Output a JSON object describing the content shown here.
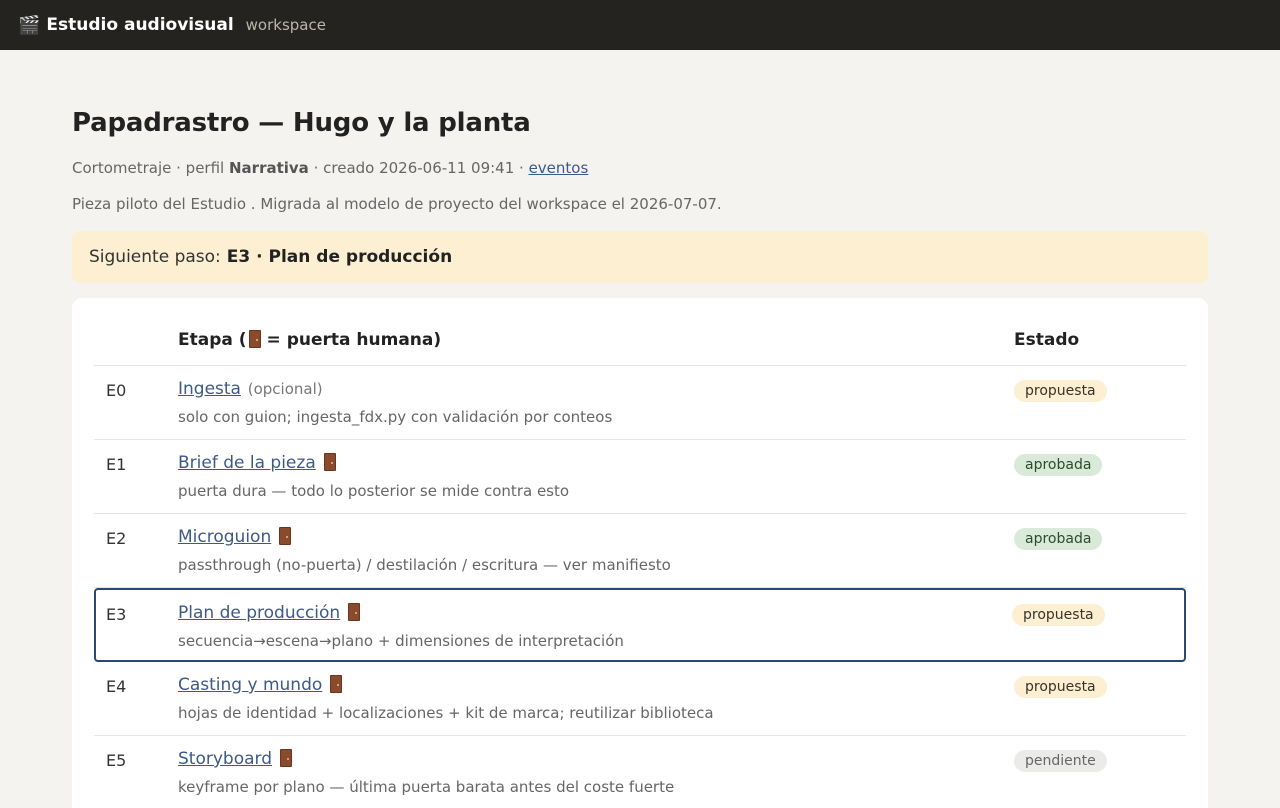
{
  "app": {
    "icon": "clapperboard-icon",
    "brand": "Estudio audiovisual",
    "sub": "workspace"
  },
  "project": {
    "title": "Papadrastro — Hugo y la planta",
    "type": "Cortometraje",
    "perfil_label": "perfil",
    "perfil": "Narrativa",
    "created": "creado 2026-06-11 09:41",
    "events_link": "eventos",
    "description": "Pieza piloto del Estudio . Migrada al modelo de proyecto del workspace el 2026-07-07."
  },
  "next": {
    "label": "Siguiente paso:",
    "value": "E3 · Plan de producción"
  },
  "table": {
    "header_stage_pre": "Etapa (",
    "header_stage_post": "= puerta humana)",
    "header_state": "Estado",
    "rows": [
      {
        "id": "E0",
        "name": "Ingesta",
        "optional": "(opcional)",
        "door": false,
        "note": "solo con guion; ingesta_fdx.py con validación por conteos",
        "state": "propuesta"
      },
      {
        "id": "E1",
        "name": "Brief de la pieza",
        "optional": "",
        "door": true,
        "note": "puerta dura — todo lo posterior se mide contra esto",
        "state": "aprobada"
      },
      {
        "id": "E2",
        "name": "Microguion",
        "optional": "",
        "door": true,
        "note": "passthrough (no-puerta) / destilación / escritura — ver manifiesto",
        "state": "aprobada"
      },
      {
        "id": "E3",
        "name": "Plan de producción",
        "optional": "",
        "door": true,
        "note": "secuencia→escena→plano + dimensiones de interpretación",
        "state": "propuesta"
      },
      {
        "id": "E4",
        "name": "Casting y mundo",
        "optional": "",
        "door": true,
        "note": "hojas de identidad + localizaciones + kit de marca; reutilizar biblioteca",
        "state": "propuesta"
      },
      {
        "id": "E5",
        "name": "Storyboard",
        "optional": "",
        "door": true,
        "note": "keyframe por plano — última puerta barata antes del coste fuerte",
        "state": "pendiente"
      }
    ]
  }
}
